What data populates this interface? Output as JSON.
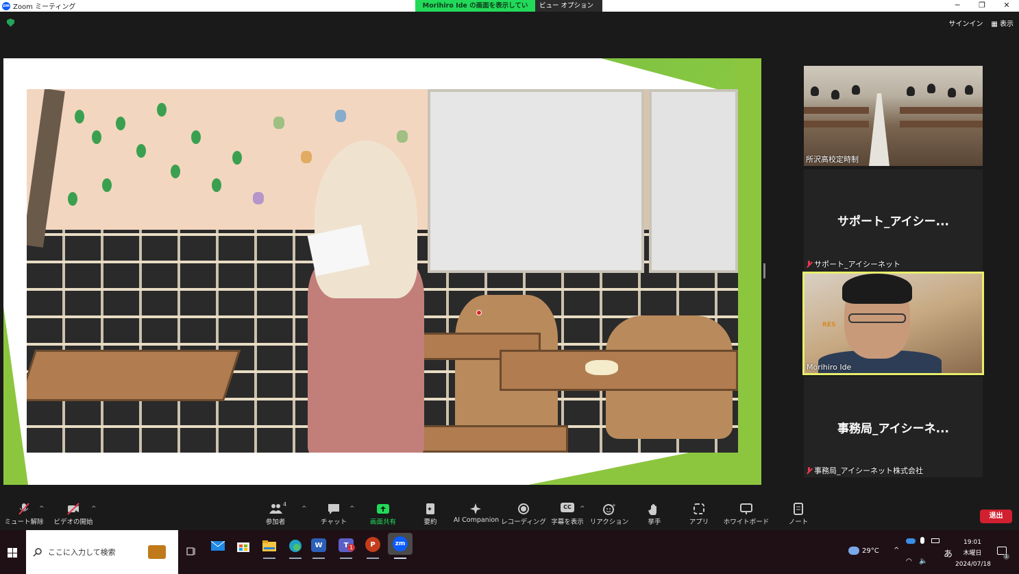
{
  "window": {
    "title": "Zoom ミーティング",
    "logo_text": "zm",
    "controls": [
      "─",
      "❐",
      "✕"
    ]
  },
  "share_banner": {
    "status": "Morihiro Ide の画面を表示しています",
    "view_options": "ビュー オプション ⌄"
  },
  "top_right": {
    "sign_in": "サインイン",
    "view": "表示"
  },
  "tiles": [
    {
      "name": "所沢高校定時制",
      "muted": false
    },
    {
      "display_name": "サポート_アイシー...",
      "name": "サポート_アイシーネット",
      "muted": true
    },
    {
      "name": "Morihiro Ide",
      "muted": false,
      "active": true,
      "sign_text": "RES"
    },
    {
      "display_name": "事務局_アイシーネ...",
      "name": "事務局_アイシーネット株式会社",
      "muted": true
    }
  ],
  "toolbar": {
    "unmute": "ミュート解除",
    "start_video": "ビデオの開始",
    "participants": "参加者",
    "participants_count": "4",
    "chat": "チャット",
    "share_screen": "画面共有",
    "summary": "要約",
    "ai_companion": "AI Companion",
    "recording": "レコーディング",
    "captions": "字幕を表示",
    "reactions": "リアクション",
    "raise_hand": "挙手",
    "apps": "アプリ",
    "whiteboard": "ホワイトボード",
    "notes": "ノート",
    "leave": "退出",
    "captions_icon": "CC"
  },
  "taskbar": {
    "search_placeholder": "ここに入力して検索",
    "apps": [
      "outlook",
      "store",
      "explorer",
      "edge",
      "word",
      "teams",
      "powerpoint",
      "zoom"
    ],
    "app_labels": {
      "word": "W",
      "teams": "T",
      "powerpoint": "P",
      "zoom": "zm"
    },
    "teams_badge": "1",
    "weather": "29°C",
    "ime": "あ",
    "time": "19:01",
    "weekday": "木曜日",
    "date": "2024/07/18",
    "notification_count": "1"
  },
  "colors": {
    "share_green": "#23d959",
    "leave_red": "#d1202f",
    "active_speaker": "#e8ef6b",
    "slide_green": "#8cc63f"
  }
}
